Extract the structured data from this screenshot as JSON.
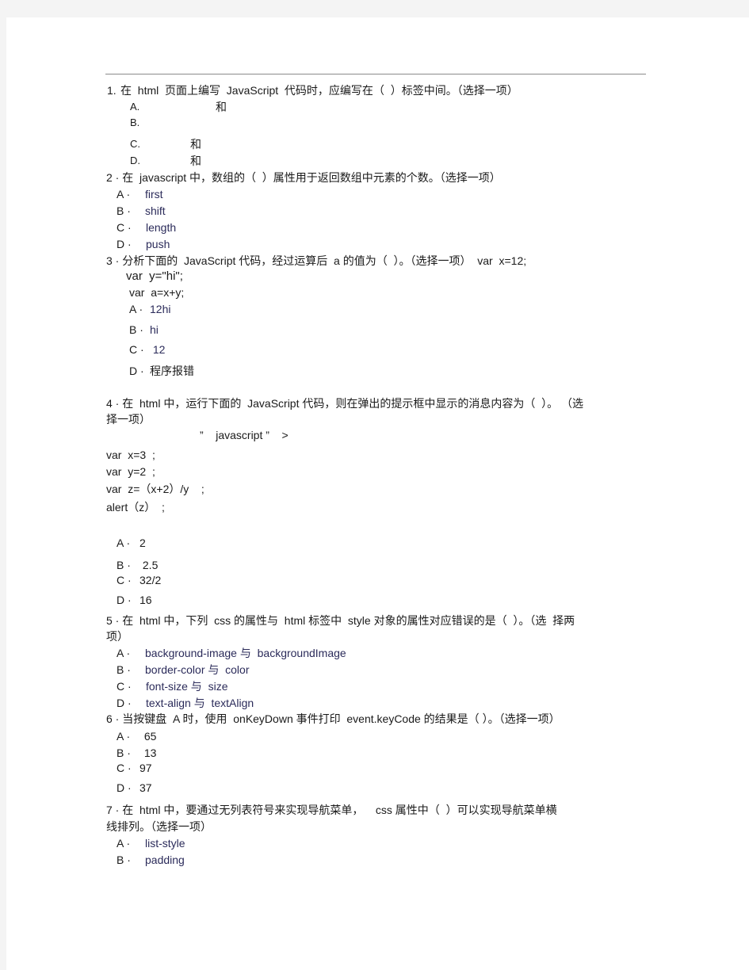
{
  "document": {
    "questions": [
      {
        "number": "1.",
        "text": "在  html  页面上编写  JavaScript  代码时，应编写在（  ）标签中间。（选择一项）",
        "options": [
          {
            "label": "A.",
            "text": "和"
          },
          {
            "label": "B.",
            "text": ""
          },
          {
            "label": "C.",
            "text": "和"
          },
          {
            "label": "D.",
            "text": "和"
          }
        ]
      },
      {
        "number": "2",
        "text": "2 · 在  javascript 中，数组的（  ）属性用于返回数组中元素的个数。（选择一项）",
        "options": [
          {
            "label": "A ·",
            "text": "first"
          },
          {
            "label": "B ·",
            "text": "shift"
          },
          {
            "label": "C ·",
            "text": "length"
          },
          {
            "label": "D ·",
            "text": "push"
          }
        ]
      },
      {
        "number": "3",
        "text": "3 · 分析下面的  JavaScript 代码，经过运算后  a 的值为（  ）。（选择一项）  var  x=12;",
        "code": [
          "var  y=\"hi\";",
          "var  a=x+y;"
        ],
        "options": [
          {
            "label": "A ·",
            "text": "12hi"
          },
          {
            "label": "B ·",
            "text": "hi"
          },
          {
            "label": "C ·",
            "text": " 12"
          },
          {
            "label": "D ·",
            "text": "程序报错"
          }
        ]
      },
      {
        "number": "4",
        "text_line1": "4 · 在  html 中，运行下面的  JavaScript 代码，则在弹出的提示框中显示的消息内容为（  ）。 （选",
        "text_line2": "择一项）",
        "script_tag": "”    javascript ”    >",
        "code": [
          "var  x=3  ;",
          "var  y=2  ;",
          "var  z=（x+2）/y    ;",
          "alert（z）  ;"
        ],
        "options": [
          {
            "label": "A ·",
            "text": "2"
          },
          {
            "label": "B ·",
            "text": " 2.5"
          },
          {
            "label": "C ·",
            "text": "32/2"
          },
          {
            "label": "D ·",
            "text": "16"
          }
        ]
      },
      {
        "number": "5",
        "text_line1": "5 · 在  html 中，下列  css 的属性与  html 标签中  style 对象的属性对应错误的是（  ）。（选  择两",
        "text_line2": "项）",
        "options": [
          {
            "label": "A ·",
            "text": "background-image 与  backgroundImage"
          },
          {
            "label": "B ·",
            "text": "border-color 与  color"
          },
          {
            "label": "C ·",
            "text": "font-size 与  size"
          },
          {
            "label": "D ·",
            "text": "text-align 与  textAlign"
          }
        ]
      },
      {
        "number": "6",
        "text": "6 · 当按键盘  A 时，使用  onKeyDown 事件打印  event.keyCode 的结果是（ ）。（选择一项）",
        "options": [
          {
            "label": "A ·",
            "text": " 65"
          },
          {
            "label": "B ·",
            "text": " 13"
          },
          {
            "label": "C ·",
            "text": "97"
          },
          {
            "label": "D ·",
            "text": "37"
          }
        ]
      },
      {
        "number": "7",
        "text_line1": "7 · 在  html 中，要通过无列表符号来实现导航菜单，    css 属性中（  ）可以实现导航菜单横",
        "text_line2": "线排列。（选择一项）",
        "options": [
          {
            "label": "A ·",
            "text": "list-style"
          },
          {
            "label": "B ·",
            "text": "padding"
          }
        ]
      }
    ]
  }
}
